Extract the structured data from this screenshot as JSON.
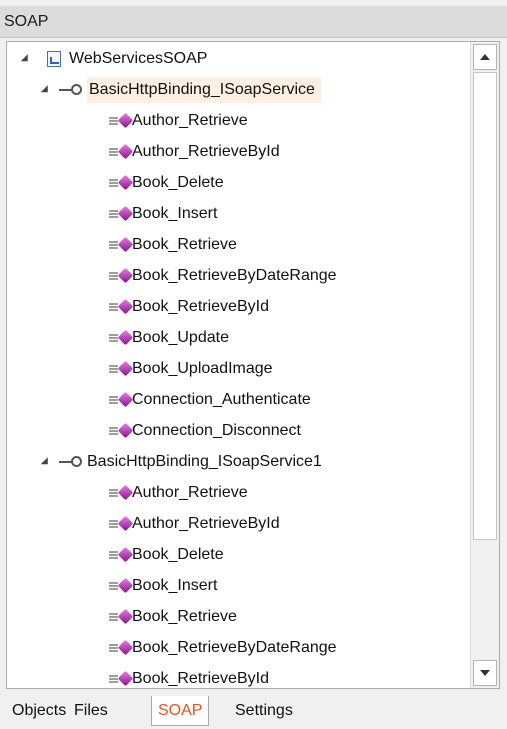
{
  "panel": {
    "title": "SOAP"
  },
  "tree": {
    "root": {
      "label": "WebServicesSOAP",
      "icon": "wsdl-document-icon"
    },
    "bindings": [
      {
        "label": "BasicHttpBinding_ISoapService",
        "icon": "binding-connector-icon",
        "selected": true,
        "methods": [
          "Author_Retrieve",
          "Author_RetrieveById",
          "Book_Delete",
          "Book_Insert",
          "Book_Retrieve",
          "Book_RetrieveByDateRange",
          "Book_RetrieveById",
          "Book_Update",
          "Book_UploadImage",
          "Connection_Authenticate",
          "Connection_Disconnect"
        ]
      },
      {
        "label": "BasicHttpBinding_ISoapService1",
        "icon": "binding-connector-icon",
        "selected": false,
        "methods": [
          "Author_Retrieve",
          "Author_RetrieveById",
          "Book_Delete",
          "Book_Insert",
          "Book_Retrieve",
          "Book_RetrieveByDateRange",
          "Book_RetrieveById"
        ]
      }
    ],
    "method_icon": "method-gem-icon"
  },
  "tabs": [
    {
      "label": "Objects",
      "active": false
    },
    {
      "label": "Files",
      "active": false
    },
    {
      "label": "SOAP",
      "active": true
    },
    {
      "label": "Settings",
      "active": false
    }
  ],
  "colors": {
    "active_tab_text": "#e0551f",
    "selected_row_bg": "#fdf0e2"
  }
}
